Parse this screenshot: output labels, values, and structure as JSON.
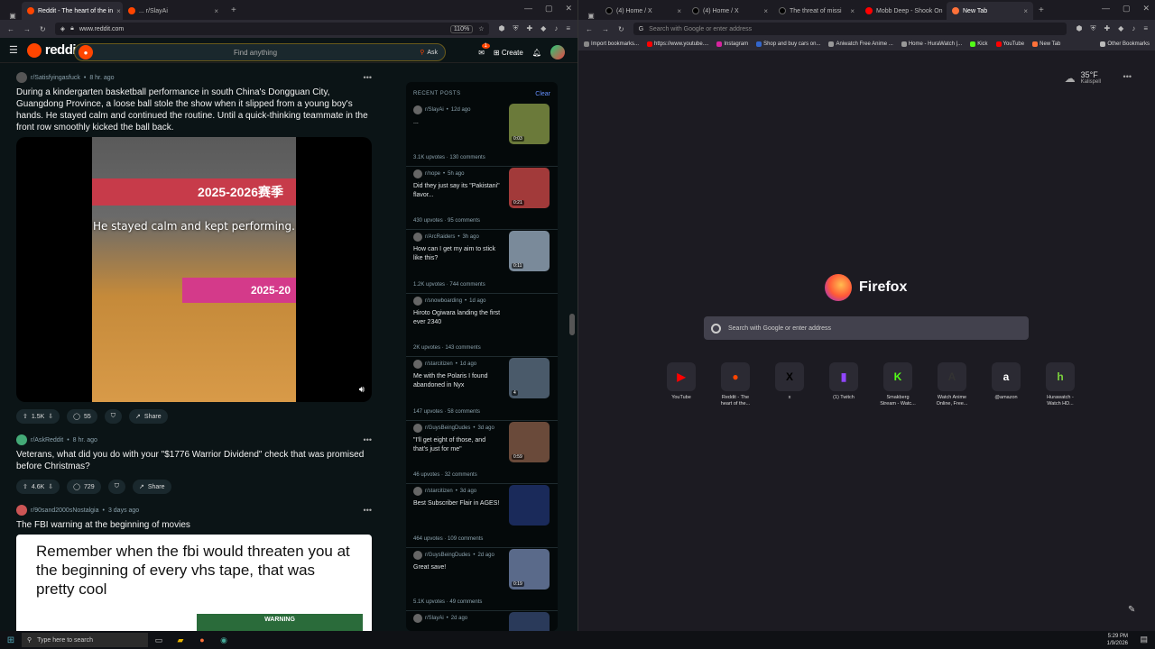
{
  "left_window": {
    "tabs": [
      {
        "title": "Reddit - The heart of the in",
        "active": true
      },
      {
        "title": "... r/SlayAi",
        "active": false
      }
    ],
    "zoom": "110%",
    "url": "www.reddit.com"
  },
  "reddit": {
    "logo": "reddit",
    "search_placeholder": "Find anything",
    "ask_label": "Ask",
    "create_label": "Create",
    "notif_count": "1",
    "posts": [
      {
        "sub": "r/Satisfyingasfuck",
        "age": "8 hr. ago",
        "title": "During a kindergarten basketball performance in south China's Dongguan City, Guangdong Province, a loose ball stole the show when it slipped from a young boy's hands. He stayed calm and continued the routine. Until a quick-thinking teammate in the front row smoothly kicked the ball back.",
        "votes": "1.5K",
        "comments": "55",
        "share": "Share",
        "media_sign": "2025-2026赛季",
        "media_caption": "He stayed calm and kept performing.",
        "media_band": "2025-20"
      },
      {
        "sub": "r/AskReddit",
        "age": "8 hr. ago",
        "title": "Veterans, what did you do with your \"$1776 Warrior Dividend\" check that was promised before Christmas?",
        "votes": "4.6K",
        "comments": "729",
        "share": "Share"
      },
      {
        "sub": "r/90sand2000sNostalgia",
        "age": "3 days ago",
        "title": "The FBI warning at the beginning of movies",
        "image_text": "Remember when the fbi would threaten you at the beginning of every vhs tape, that was pretty cool",
        "warning": "WARNING"
      }
    ],
    "recent": {
      "header": "RECENT POSTS",
      "clear": "Clear",
      "items": [
        {
          "sub": "r/SlayAi",
          "age": "12d ago",
          "title": "...",
          "upvotes": "3.1K upvotes",
          "comments": "130 comments",
          "duration": "0:03",
          "color": "#6b7a3a"
        },
        {
          "sub": "r/nope",
          "age": "5h ago",
          "title": "Did they just say its \"Pakistani\" flavor...",
          "upvotes": "430 upvotes",
          "comments": "95 comments",
          "duration": "0:21",
          "color": "#a23a3a"
        },
        {
          "sub": "r/ArcRaiders",
          "age": "3h ago",
          "title": "How can I get my aim to stick like this?",
          "upvotes": "1.2K upvotes",
          "comments": "744 comments",
          "duration": "0:11",
          "color": "#7a8a9a"
        },
        {
          "sub": "r/snowboarding",
          "age": "1d ago",
          "title": "Hiroto Ogiwara landing the first ever 2340",
          "upvotes": "2K upvotes",
          "comments": "143 comments",
          "duration": "",
          "color": ""
        },
        {
          "sub": "r/starcitizen",
          "age": "1d ago",
          "title": "Me with the Polaris I found abandoned in Nyx",
          "upvotes": "147 upvotes",
          "comments": "58 comments",
          "duration": "4",
          "color": "#4a5a6a"
        },
        {
          "sub": "r/GuysBeingDudes",
          "age": "3d ago",
          "title": "\"I'll get eight of those, and that's just for me\"",
          "upvotes": "46 upvotes",
          "comments": "32 comments",
          "duration": "0:59",
          "color": "#6a4a3a"
        },
        {
          "sub": "r/starcitizen",
          "age": "3d ago",
          "title": "Best Subscriber Flair in AGES!",
          "upvotes": "464 upvotes",
          "comments": "109 comments",
          "duration": "",
          "color": "#1a2a5a"
        },
        {
          "sub": "r/GuysBeingDudes",
          "age": "2d ago",
          "title": "Great save!",
          "upvotes": "5.1K upvotes",
          "comments": "49 comments",
          "duration": "0:19",
          "color": "#5a6a8a"
        },
        {
          "sub": "r/SlayAi",
          "age": "2d ago",
          "title": "",
          "upvotes": "",
          "comments": "",
          "duration": "",
          "color": "#2a3a5a"
        }
      ]
    }
  },
  "right_window": {
    "tabs": [
      {
        "title": "(4) Home / X",
        "active": false
      },
      {
        "title": "(4) Home / X",
        "active": false
      },
      {
        "title": "The threat of missi",
        "active": false
      },
      {
        "title": "Mobb Deep - Shook On",
        "active": false
      },
      {
        "title": "New Tab",
        "active": true
      }
    ],
    "url_placeholder": "Search with Google or enter address",
    "bookmarks": [
      "Import bookmarks...",
      "https://www.youtube....",
      "Instagram",
      "Shop and buy cars on...",
      "Aniwatch Free Anime ...",
      "Home - HuraWatch |...",
      "Kick",
      "YouTube",
      "New Tab"
    ],
    "other_bookmarks": "Other Bookmarks",
    "weather_temp": "35°F",
    "weather_loc": "Kalispell",
    "brand": "Firefox",
    "search_placeholder": "Search with Google or enter address",
    "shortcuts": [
      {
        "label": "YouTube",
        "glyph": "▶",
        "color": "#ff0000"
      },
      {
        "label": "Reddit - The heart of the...",
        "glyph": "●",
        "color": "#ff4500"
      },
      {
        "label": "x",
        "glyph": "X",
        "color": "#000000"
      },
      {
        "label": "(1) Twitch",
        "glyph": "▮",
        "color": "#9146ff"
      },
      {
        "label": "Smakberg Stream - Watc...",
        "glyph": "K",
        "color": "#53fc18"
      },
      {
        "label": "Watch Anime Online, Free...",
        "glyph": "A",
        "color": "#333333"
      },
      {
        "label": "@amazon",
        "glyph": "a",
        "color": "#ffffff"
      },
      {
        "label": "Hurawatch - Watch HD...",
        "glyph": "h",
        "color": "#7bd13d"
      }
    ]
  },
  "taskbar": {
    "search_placeholder": "Type here to search",
    "time": "5:29 PM",
    "date": "1/9/2026"
  }
}
